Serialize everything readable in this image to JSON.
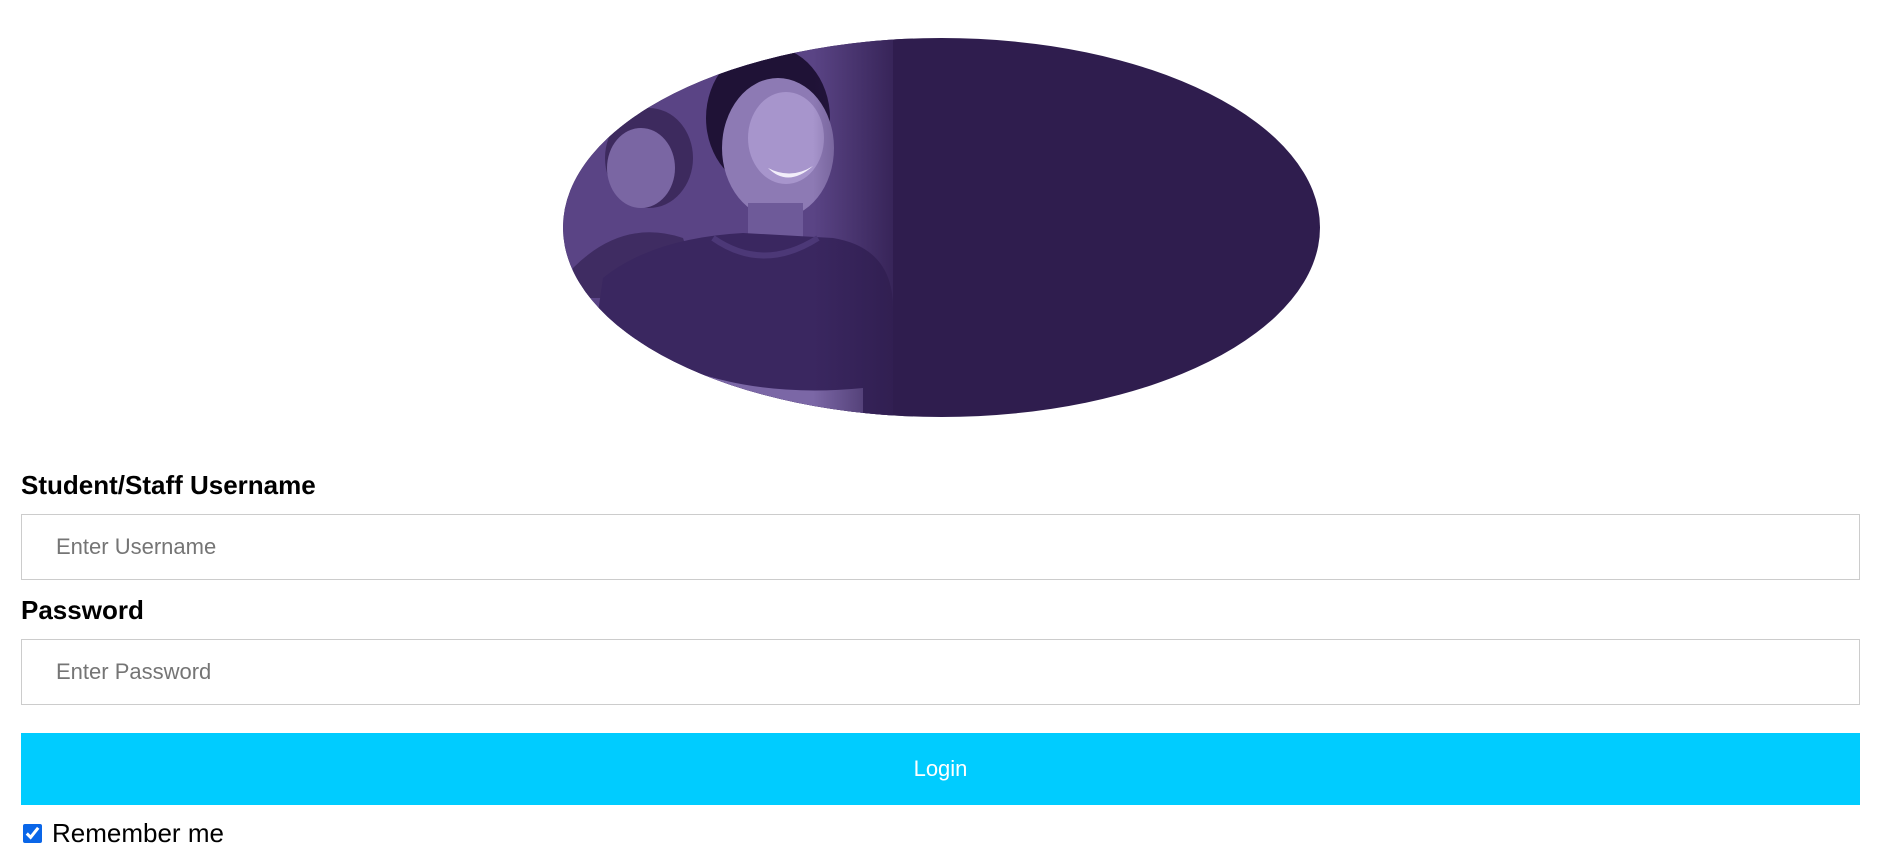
{
  "hero_image": {
    "alt": "Students smiling",
    "tint_color": "#2f1d4e"
  },
  "form": {
    "username": {
      "label": "Student/Staff Username",
      "placeholder": "Enter Username",
      "value": ""
    },
    "password": {
      "label": "Password",
      "placeholder": "Enter Password",
      "value": ""
    },
    "login_label": "Login",
    "remember_label": "Remember me",
    "remember_checked": true
  },
  "colors": {
    "login_button_bg": "#00ccff",
    "login_button_text": "#ffffff",
    "checkbox_accent": "#0a66e8"
  }
}
